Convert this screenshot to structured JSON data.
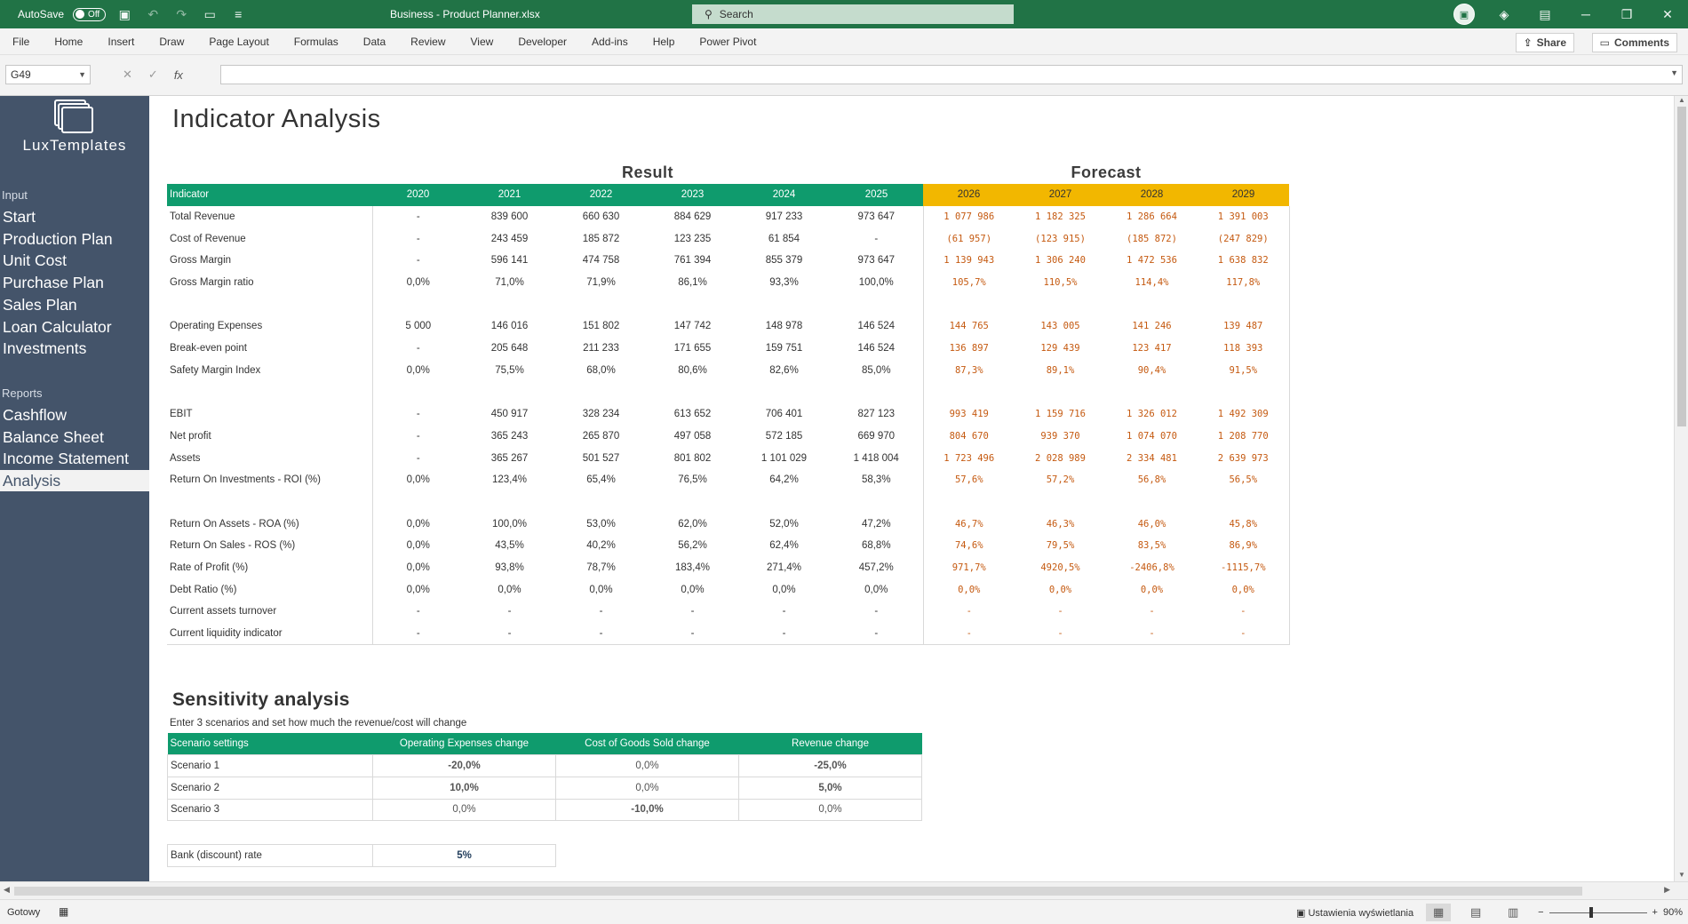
{
  "titlebar": {
    "autosave_label": "AutoSave",
    "autosave_state": "Off",
    "document_title": "Business - Product Planner.xlsx",
    "search_placeholder": "Search"
  },
  "ribbon": {
    "tabs": [
      "File",
      "Home",
      "Insert",
      "Draw",
      "Page Layout",
      "Formulas",
      "Data",
      "Review",
      "View",
      "Developer",
      "Add-ins",
      "Help",
      "Power Pivot"
    ],
    "share_label": "Share",
    "comments_label": "Comments"
  },
  "formula_bar": {
    "name_box": "G49",
    "fx_label": "fx",
    "formula": ""
  },
  "sidebar": {
    "logo_text": "LuxTemplates",
    "input_heading": "Input",
    "input_items": [
      "Start",
      "Production Plan",
      "Unit Cost",
      "Purchase Plan",
      "Sales Plan",
      "Loan Calculator",
      "Investments"
    ],
    "reports_heading": "Reports",
    "report_items": [
      "Cashflow",
      "Balance Sheet",
      "Income Statement",
      "Analysis"
    ],
    "active_item": "Analysis"
  },
  "page_title": "Indicator Analysis",
  "bands": {
    "result": "Result",
    "forecast": "Forecast"
  },
  "indicator_table": {
    "header_label": "Indicator",
    "result_years": [
      "2020",
      "2021",
      "2022",
      "2023",
      "2024",
      "2025"
    ],
    "forecast_years": [
      "2026",
      "2027",
      "2028",
      "2029"
    ],
    "rows": [
      {
        "label": "Total Revenue",
        "result": [
          "-",
          "839 600",
          "660 630",
          "884 629",
          "917 233",
          "973 647"
        ],
        "forecast": [
          "1 077 986",
          "1 182 325",
          "1 286 664",
          "1 391 003"
        ]
      },
      {
        "label": "Cost of Revenue",
        "result": [
          "-",
          "243 459",
          "185 872",
          "123 235",
          "61 854",
          "-"
        ],
        "forecast": [
          "(61 957)",
          "(123 915)",
          "(185 872)",
          "(247 829)"
        ]
      },
      {
        "label": "Gross Margin",
        "result": [
          "-",
          "596 141",
          "474 758",
          "761 394",
          "855 379",
          "973 647"
        ],
        "forecast": [
          "1 139 943",
          "1 306 240",
          "1 472 536",
          "1 638 832"
        ]
      },
      {
        "label": "Gross Margin ratio",
        "result": [
          "0,0%",
          "71,0%",
          "71,9%",
          "86,1%",
          "93,3%",
          "100,0%"
        ],
        "forecast": [
          "105,7%",
          "110,5%",
          "114,4%",
          "117,8%"
        ]
      },
      {
        "label": "",
        "result": [
          "",
          "",
          "",
          "",
          "",
          ""
        ],
        "forecast": [
          "",
          "",
          "",
          ""
        ]
      },
      {
        "label": "Operating Expenses",
        "result": [
          "5 000",
          "146 016",
          "151 802",
          "147 742",
          "148 978",
          "146 524"
        ],
        "forecast": [
          "144 765",
          "143 005",
          "141 246",
          "139 487"
        ]
      },
      {
        "label": "Break-even point",
        "result": [
          "-",
          "205 648",
          "211 233",
          "171 655",
          "159 751",
          "146 524"
        ],
        "forecast": [
          "136 897",
          "129 439",
          "123 417",
          "118 393"
        ]
      },
      {
        "label": "Safety Margin Index",
        "result": [
          "0,0%",
          "75,5%",
          "68,0%",
          "80,6%",
          "82,6%",
          "85,0%"
        ],
        "forecast": [
          "87,3%",
          "89,1%",
          "90,4%",
          "91,5%"
        ]
      },
      {
        "label": "",
        "result": [
          "",
          "",
          "",
          "",
          "",
          ""
        ],
        "forecast": [
          "",
          "",
          "",
          ""
        ]
      },
      {
        "label": "EBIT",
        "result": [
          "-",
          "450 917",
          "328 234",
          "613 652",
          "706 401",
          "827 123"
        ],
        "forecast": [
          "993 419",
          "1 159 716",
          "1 326 012",
          "1 492 309"
        ]
      },
      {
        "label": "Net profit",
        "result": [
          "-",
          "365 243",
          "265 870",
          "497 058",
          "572 185",
          "669 970"
        ],
        "forecast": [
          "804 670",
          "939 370",
          "1 074 070",
          "1 208 770"
        ]
      },
      {
        "label": "Assets",
        "result": [
          "-",
          "365 267",
          "501 527",
          "801 802",
          "1 101 029",
          "1 418 004"
        ],
        "forecast": [
          "1 723 496",
          "2 028 989",
          "2 334 481",
          "2 639 973"
        ]
      },
      {
        "label": "Return On Investments - ROI (%)",
        "result": [
          "0,0%",
          "123,4%",
          "65,4%",
          "76,5%",
          "64,2%",
          "58,3%"
        ],
        "forecast": [
          "57,6%",
          "57,2%",
          "56,8%",
          "56,5%"
        ]
      },
      {
        "label": "",
        "result": [
          "",
          "",
          "",
          "",
          "",
          ""
        ],
        "forecast": [
          "",
          "",
          "",
          ""
        ]
      },
      {
        "label": "Return On Assets - ROA (%)",
        "result": [
          "0,0%",
          "100,0%",
          "53,0%",
          "62,0%",
          "52,0%",
          "47,2%"
        ],
        "forecast": [
          "46,7%",
          "46,3%",
          "46,0%",
          "45,8%"
        ]
      },
      {
        "label": "Return On Sales - ROS (%)",
        "result": [
          "0,0%",
          "43,5%",
          "40,2%",
          "56,2%",
          "62,4%",
          "68,8%"
        ],
        "forecast": [
          "74,6%",
          "79,5%",
          "83,5%",
          "86,9%"
        ]
      },
      {
        "label": "Rate of Profit (%)",
        "result": [
          "0,0%",
          "93,8%",
          "78,7%",
          "183,4%",
          "271,4%",
          "457,2%"
        ],
        "forecast": [
          "971,7%",
          "4920,5%",
          "-2406,8%",
          "-1115,7%"
        ]
      },
      {
        "label": "Debt Ratio (%)",
        "result": [
          "0,0%",
          "0,0%",
          "0,0%",
          "0,0%",
          "0,0%",
          "0,0%"
        ],
        "forecast": [
          "0,0%",
          "0,0%",
          "0,0%",
          "0,0%"
        ]
      },
      {
        "label": "Current assets turnover",
        "result": [
          "-",
          "-",
          "-",
          "-",
          "-",
          "-"
        ],
        "forecast": [
          "-",
          "-",
          "-",
          "-"
        ]
      },
      {
        "label": "Current liquidity indicator",
        "result": [
          "-",
          "-",
          "-",
          "-",
          "-",
          "-"
        ],
        "forecast": [
          "-",
          "-",
          "-",
          "-"
        ]
      }
    ]
  },
  "sensitivity": {
    "title": "Sensitivity analysis",
    "subtitle": "Enter 3 scenarios and set how much the revenue/cost will change",
    "headers": [
      "Scenario settings",
      "Operating Expenses change",
      "Cost of Goods Sold change",
      "Revenue change"
    ],
    "rows": [
      {
        "label": "Scenario 1",
        "values": [
          "-20,0%",
          "0,0%",
          "-25,0%"
        ],
        "styles": [
          "neg-teal",
          "",
          "neg"
        ]
      },
      {
        "label": "Scenario 2",
        "values": [
          "10,0%",
          "0,0%",
          "5,0%"
        ],
        "styles": [
          "neg",
          "",
          "pos"
        ]
      },
      {
        "label": "Scenario 3",
        "values": [
          "0,0%",
          "-10,0%",
          "0,0%"
        ],
        "styles": [
          "",
          "neg-teal",
          ""
        ]
      }
    ]
  },
  "bank_rate": {
    "label": "Bank (discount) rate",
    "value": "5%"
  },
  "statusbar": {
    "ready": "Gotowy",
    "display_settings": "Ustawienia wyświetlania",
    "zoom": "90%",
    "zoom_level": 0.43
  }
}
